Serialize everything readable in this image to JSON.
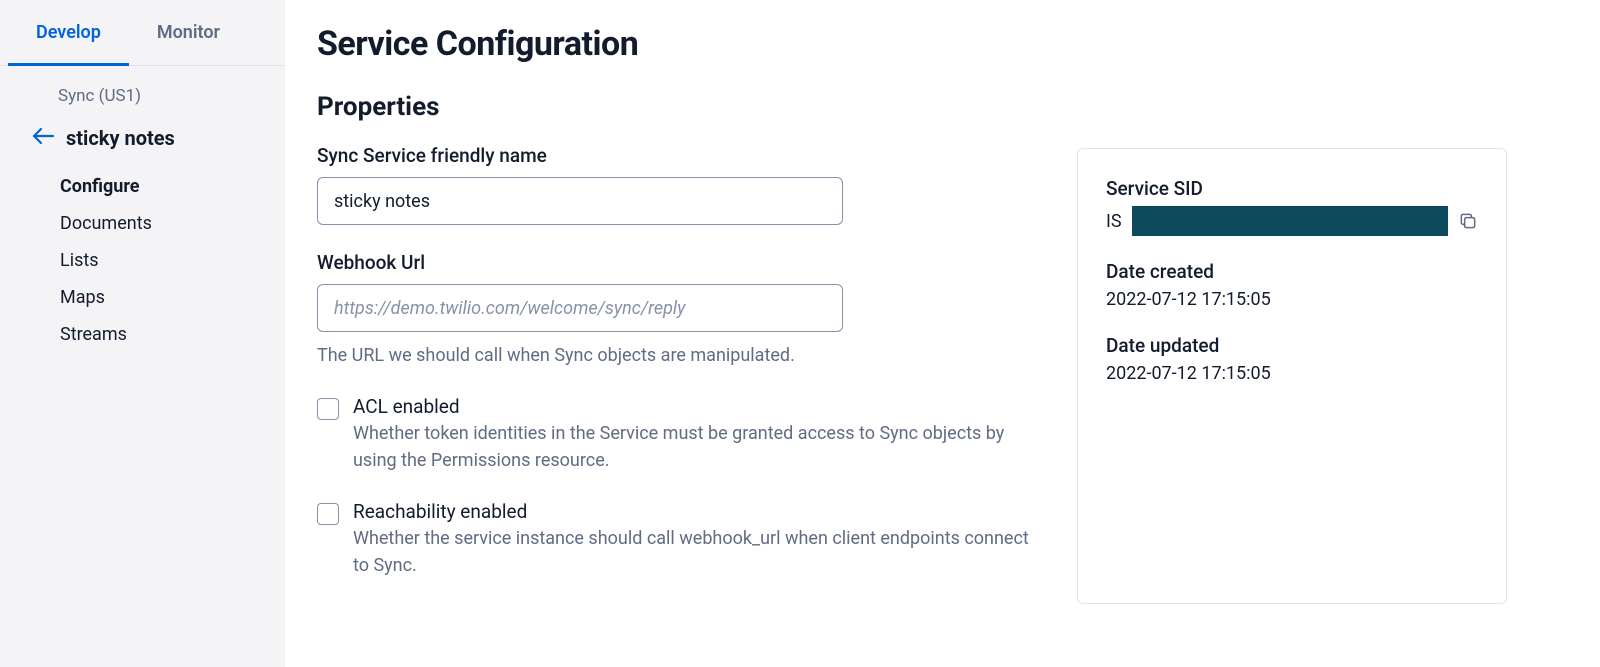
{
  "sidebar": {
    "tabs": [
      {
        "label": "Develop",
        "active": true
      },
      {
        "label": "Monitor",
        "active": false
      }
    ],
    "breadcrumb": "Sync (US1)",
    "back_title": "sticky notes",
    "nav": [
      {
        "label": "Configure",
        "active": true
      },
      {
        "label": "Documents",
        "active": false
      },
      {
        "label": "Lists",
        "active": false
      },
      {
        "label": "Maps",
        "active": false
      },
      {
        "label": "Streams",
        "active": false
      }
    ]
  },
  "page": {
    "title": "Service Configuration",
    "section_title": "Properties",
    "friendly_name": {
      "label": "Sync Service friendly name",
      "value": "sticky notes"
    },
    "webhook": {
      "label": "Webhook Url",
      "placeholder": "https://demo.twilio.com/welcome/sync/reply",
      "help": "The URL we should call when Sync objects are manipulated."
    },
    "acl": {
      "label": "ACL enabled",
      "desc": "Whether token identities in the Service must be granted access to Sync objects by using the Permissions resource."
    },
    "reachability": {
      "label": "Reachability enabled",
      "desc": "Whether the service instance should call webhook_url when client endpoints connect to Sync."
    }
  },
  "info": {
    "sid_label": "Service SID",
    "sid_prefix": "IS",
    "created_label": "Date created",
    "created_value": "2022-07-12 17:15:05",
    "updated_label": "Date updated",
    "updated_value": "2022-07-12 17:15:05"
  }
}
